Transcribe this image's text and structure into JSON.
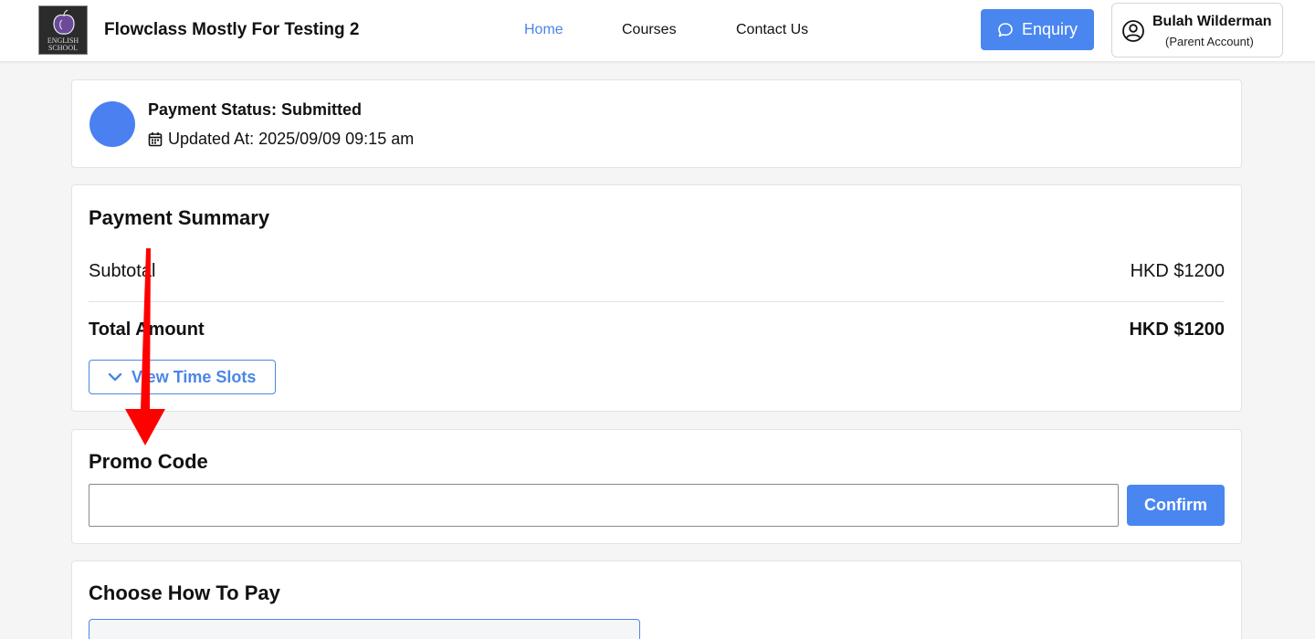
{
  "header": {
    "logo_text_line1": "ENGLISH",
    "logo_text_line2": "SCHOOL",
    "brand": "Flowclass Mostly For Testing 2",
    "nav": [
      {
        "label": "Home",
        "active": true
      },
      {
        "label": "Courses",
        "active": false
      },
      {
        "label": "Contact Us",
        "active": false
      }
    ],
    "enquiry_label": "Enquiry",
    "account_name": "Bulah Wilderman",
    "account_role": "(Parent Account)"
  },
  "status": {
    "title": "Payment Status: Submitted",
    "updated": "Updated At: 2025/09/09 09:15 am"
  },
  "summary": {
    "title": "Payment Summary",
    "subtotal_label": "Subtotal",
    "subtotal_value": "HKD $1200",
    "total_label": "Total Amount",
    "total_value": "HKD $1200",
    "time_slots_label": "View Time Slots"
  },
  "promo": {
    "title": "Promo Code",
    "input_value": "",
    "input_placeholder": "",
    "confirm_label": "Confirm"
  },
  "pay": {
    "title": "Choose How To Pay"
  },
  "colors": {
    "accent": "#4a86f0",
    "status_dot": "#4a80f0",
    "annotation_arrow": "#ff0000"
  },
  "icons": {
    "enquiry": "chat-bubble-icon",
    "account": "user-circle-icon",
    "updated": "calendar-icon",
    "time_slots": "chevron-down-icon"
  }
}
